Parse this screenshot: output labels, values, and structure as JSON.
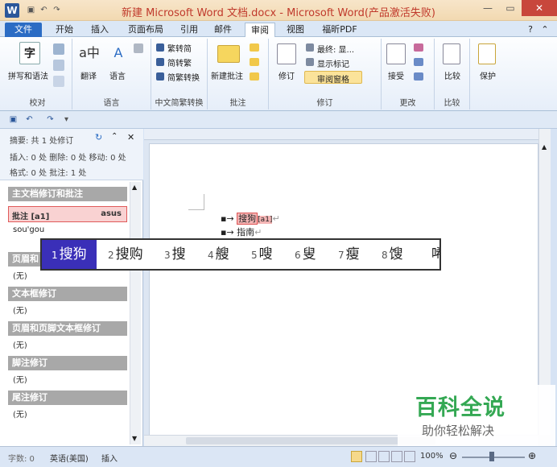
{
  "window": {
    "title": "新建 Microsoft Word 文档.docx - Microsoft Word(产品激活失败)",
    "app_letter": "W",
    "colors": {
      "title_text": "#c0392b",
      "file_tab": "#2b6cc4",
      "close_btn": "#c8473c"
    }
  },
  "tabs": [
    "文件",
    "开始",
    "插入",
    "页面布局",
    "引用",
    "邮件",
    "审阅",
    "视图",
    "福昕PDF"
  ],
  "active_tab": "审阅",
  "ribbon": {
    "groups": [
      {
        "label": "校对",
        "buttons": [
          "拼写和语法"
        ]
      },
      {
        "label": "语言",
        "buttons": [
          "翻译",
          "语言"
        ]
      },
      {
        "label": "中文简繁转换",
        "buttons": [
          "繁转简",
          "简转繁",
          "简繁转换"
        ]
      },
      {
        "label": "批注",
        "buttons": [
          "新建批注"
        ]
      },
      {
        "label": "修订",
        "buttons": [
          "修订",
          "最终: 显...",
          "显示标记",
          "审阅窗格"
        ]
      },
      {
        "label": "更改",
        "buttons": [
          "接受"
        ]
      },
      {
        "label": "比较",
        "buttons": [
          "比较"
        ]
      },
      {
        "label": "",
        "buttons": [
          "保护"
        ]
      }
    ]
  },
  "review_pane": {
    "summary": "摘要: 共 1 处修订",
    "line2": "插入: 0 处  删除: 0 处  移动: 0 处",
    "line3": "格式: 0 处  批注: 1 处",
    "main_section": "主文档修订和批注",
    "comment_label": "批注 [a1]",
    "comment_author": "asus",
    "comment_text": "sou'gou",
    "sections": [
      "页眉和",
      "文本框修订",
      "页眉和页脚文本框修订",
      "脚注修订",
      "尾注修订"
    ],
    "none_text": "(无)"
  },
  "document": {
    "line1": "搜狗",
    "line1_tag": "[a1]",
    "line2": "指南"
  },
  "ime": {
    "candidates": [
      {
        "num": "1",
        "text": "搜狗"
      },
      {
        "num": "2",
        "text": "搜购"
      },
      {
        "num": "3",
        "text": "搜"
      },
      {
        "num": "4",
        "text": "艘"
      },
      {
        "num": "5",
        "text": "嗖"
      },
      {
        "num": "6",
        "text": "叟"
      },
      {
        "num": "7",
        "text": "瘦"
      },
      {
        "num": "8",
        "text": "馊"
      },
      {
        "num": "",
        "text": "唏"
      }
    ],
    "highlight": "#3a2fb8"
  },
  "status": {
    "words": "字数: 0",
    "language": "英语(美国)",
    "mode": "插入",
    "zoom": "100%"
  },
  "watermark": {
    "title": "百科全说",
    "subtitle": "助你轻松解决"
  }
}
